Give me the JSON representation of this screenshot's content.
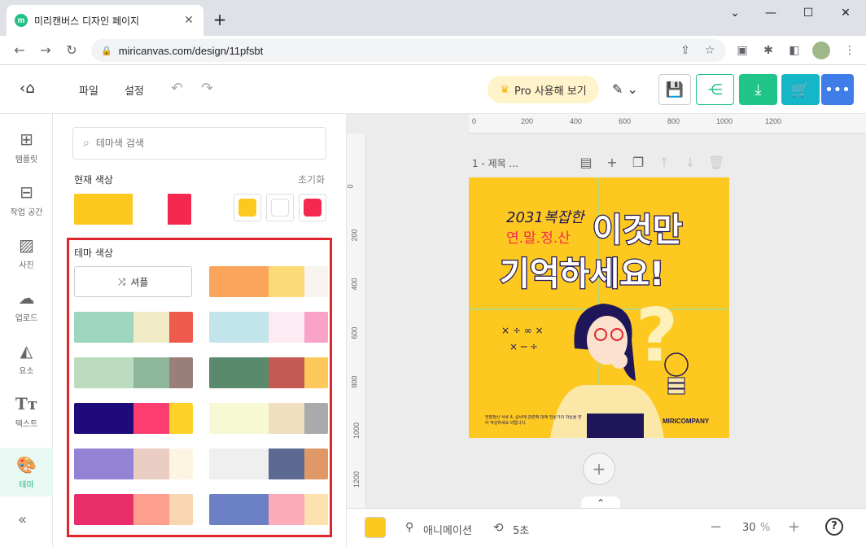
{
  "browser": {
    "tab_title": "미리캔버스 디자인 페이지",
    "url": "miricanvas.com/design/11pfsbt",
    "favicon_letter": "m"
  },
  "header": {
    "menu_file": "파일",
    "menu_settings": "설정",
    "pro_label": "Pro 사용해 보기"
  },
  "rail": [
    {
      "label": "템플릿",
      "icon": "template-icon"
    },
    {
      "label": "작업 공간",
      "icon": "workspace-icon"
    },
    {
      "label": "사진",
      "icon": "photo-icon"
    },
    {
      "label": "업로드",
      "icon": "upload-icon"
    },
    {
      "label": "요소",
      "icon": "elements-icon"
    },
    {
      "label": "텍스트",
      "icon": "text-icon"
    },
    {
      "label": "테마",
      "icon": "theme-icon"
    }
  ],
  "panel": {
    "search_placeholder": "테마색 검색",
    "current_colors_label": "현재 색상",
    "reset_label": "초기화",
    "theme_colors_label": "테마 색상",
    "shuffle_label": "셔플",
    "current_palette": [
      "#fdc81f",
      "#ffffff",
      "#f5294f"
    ],
    "current_squares": [
      "#fdc81f",
      "#ffffff",
      "#f5294f"
    ],
    "palettes": [
      {
        "colors": [
          "#fba55c",
          "#fdda78",
          "#f8f4ee"
        ],
        "weights": [
          50,
          30,
          20
        ]
      },
      {
        "colors": [
          "#9dd6be",
          "#f0eac6",
          "#ef5a4e"
        ],
        "weights": [
          50,
          30,
          20
        ]
      },
      {
        "colors": [
          "#c2e5ec",
          "#fcebf3",
          "#f9a3c8"
        ],
        "weights": [
          50,
          30,
          20
        ]
      },
      {
        "colors": [
          "#bcdcc0",
          "#8fb89a",
          "#9a7f79"
        ],
        "weights": [
          50,
          30,
          20
        ]
      },
      {
        "colors": [
          "#5a8a6c",
          "#c35a55",
          "#fdc95c"
        ],
        "weights": [
          50,
          30,
          20
        ]
      },
      {
        "colors": [
          "#1f0a7a",
          "#fb3d6f",
          "#fdd32a"
        ],
        "weights": [
          50,
          30,
          20
        ]
      },
      {
        "colors": [
          "#f7f9d4",
          "#f0dfbf",
          "#aaaaaa"
        ],
        "weights": [
          50,
          30,
          20
        ]
      },
      {
        "colors": [
          "#9383d4",
          "#eacdc2",
          "#fdf4e2"
        ],
        "weights": [
          50,
          30,
          20
        ]
      },
      {
        "colors": [
          "#efefef",
          "#5c6a92",
          "#de9966"
        ],
        "weights": [
          50,
          30,
          20
        ]
      },
      {
        "colors": [
          "#e82d6a",
          "#fe9f8d",
          "#f8d6af"
        ],
        "weights": [
          50,
          30,
          20
        ]
      },
      {
        "colors": [
          "#6b80c5",
          "#fdabb9",
          "#fde2b0"
        ],
        "weights": [
          50,
          30,
          20
        ]
      }
    ]
  },
  "canvas": {
    "page_label": "1 - 제목 ...",
    "ruler_top": [
      "0",
      "200",
      "400",
      "600",
      "800",
      "1000",
      "1200"
    ],
    "ruler_left": [
      "0",
      "200",
      "400",
      "600",
      "800",
      "1000",
      "1200"
    ],
    "design": {
      "line1": "2031복잡한",
      "line2": "연.말.정.산",
      "line3": "이것만",
      "line4": "기억하세요!",
      "footer_text": "연말정산 서류 4, 준비에 관련해 대해 전문가의 자문을 받아 작성하세요 바랍니다.",
      "brand": "MIRICOMPANY"
    },
    "colors": {
      "bg": "#fdc81f",
      "navy": "#1f1659",
      "pink": "#f5294f"
    }
  },
  "bottom": {
    "animation_label": "애니메이션",
    "duration_label": "5초",
    "zoom_value": "30",
    "zoom_unit": "%",
    "current_color": "#fdc81f"
  }
}
